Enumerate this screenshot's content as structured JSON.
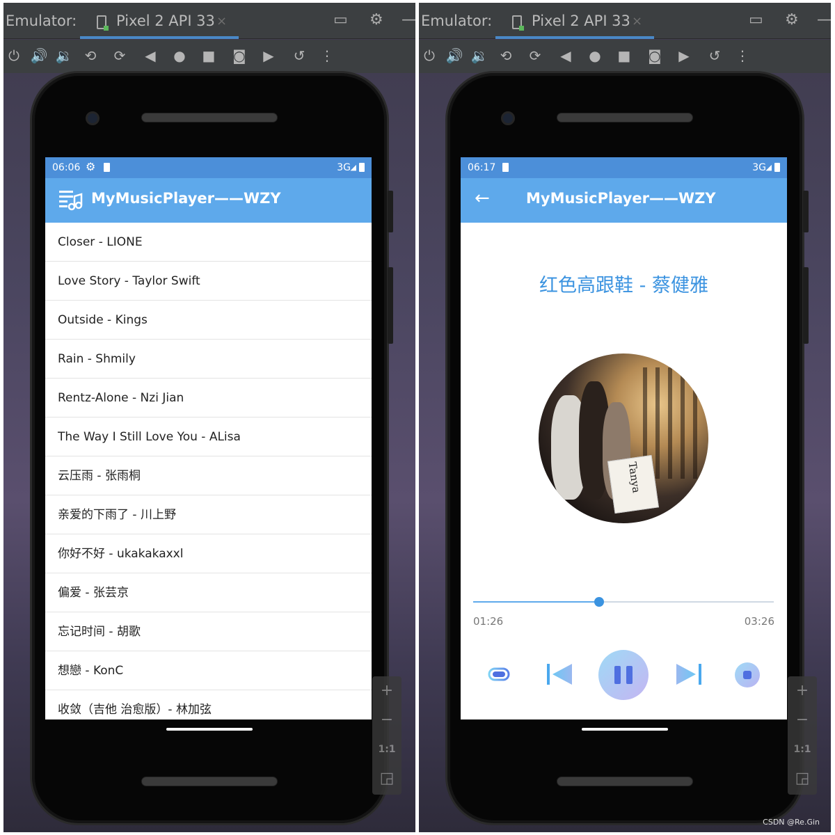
{
  "left_window": {
    "emulator_label": "Emulator:",
    "tab_name": "Pixel 2 API 33",
    "tab_close": "×",
    "status_time": "06:06",
    "status_network": "3G",
    "app_title": "MyMusicPlayer——WZY",
    "songs": [
      "Closer - LIONE",
      "Love Story - Taylor Swift",
      "Outside - Kings",
      "Rain - Shmily",
      "Rentz-Alone - Nzi  Jian",
      "The Way I Still Love You - ALisa",
      "云压雨 - 张雨桐",
      "亲爱的下雨了 - 川上野",
      "你好不好 - ukakakaxxl",
      "偏爱 - 张芸京",
      "忘记时间 - 胡歌",
      "想戀 - KonC",
      "收敛（吉他 治愈版）- 林加弦"
    ],
    "zoom": {
      "plus": "+",
      "minus": "−",
      "ratio": "1:1"
    }
  },
  "right_window": {
    "emulator_label": "Emulator:",
    "tab_name": "Pixel 2 API 33",
    "tab_close": "×",
    "status_time": "06:17",
    "status_network": "3G",
    "app_title": "MyMusicPlayer——WZY",
    "back_icon": "←",
    "now_playing": "红色高跟鞋 - 蔡健雅",
    "cover_text": "Tanya",
    "progress": 0.42,
    "current_time": "01:26",
    "total_time": "03:26",
    "zoom": {
      "plus": "+",
      "minus": "−",
      "ratio": "1:1"
    }
  },
  "toolbar_icons": [
    "power-icon",
    "volume-up-icon",
    "volume-down-icon",
    "rotate-left-icon",
    "rotate-right-icon",
    "back-icon",
    "home-icon",
    "overview-icon",
    "screenshot-icon",
    "screenrecord-icon",
    "snapshot-icon",
    "more-icon"
  ],
  "colors": {
    "appbar": "#5ea9eb",
    "statusbar": "#4c8fd9",
    "accent": "#3b93e0",
    "ide_bg": "#3c3f41"
  },
  "watermark": "CSDN @Re.Gin"
}
